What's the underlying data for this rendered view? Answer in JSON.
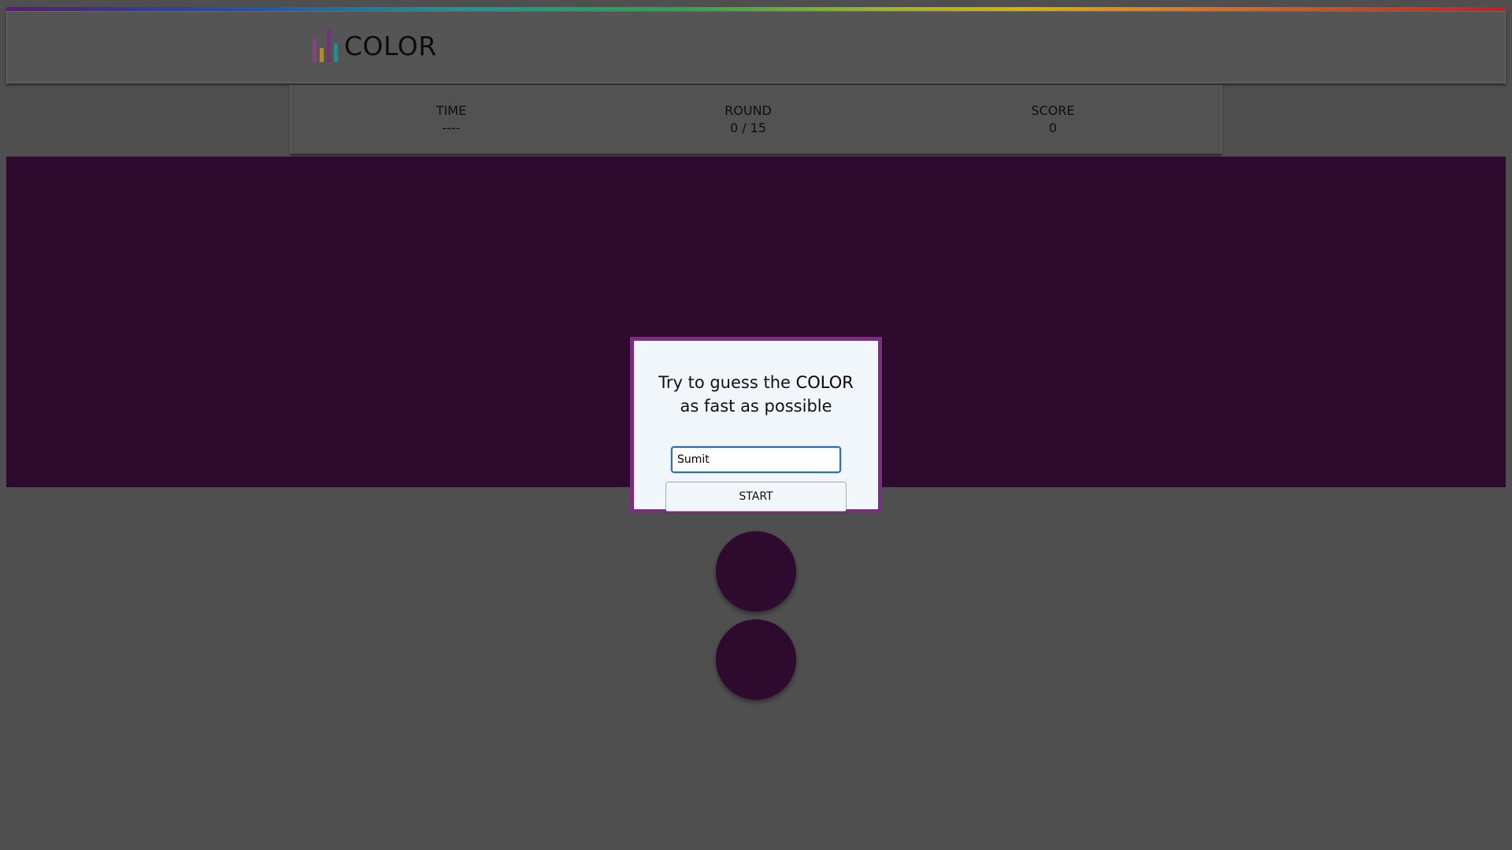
{
  "app": {
    "title": "COLOR",
    "logo_bar_colors": [
      "#8e3a8e",
      "#b08a2e",
      "#7a2e82",
      "#2e8a8a"
    ]
  },
  "stats": {
    "time_label": "TIME",
    "time_value": "----",
    "round_label": "ROUND",
    "round_value": "0 / 15",
    "score_label": "SCORE",
    "score_value": "0"
  },
  "color_swatch": "#2e0a2e",
  "modal": {
    "line1_prefix": "Try to guess the ",
    "line1_bold": "COLOR",
    "line2": "as fast as possible",
    "name_value": "Sumit",
    "start_label": "START"
  }
}
